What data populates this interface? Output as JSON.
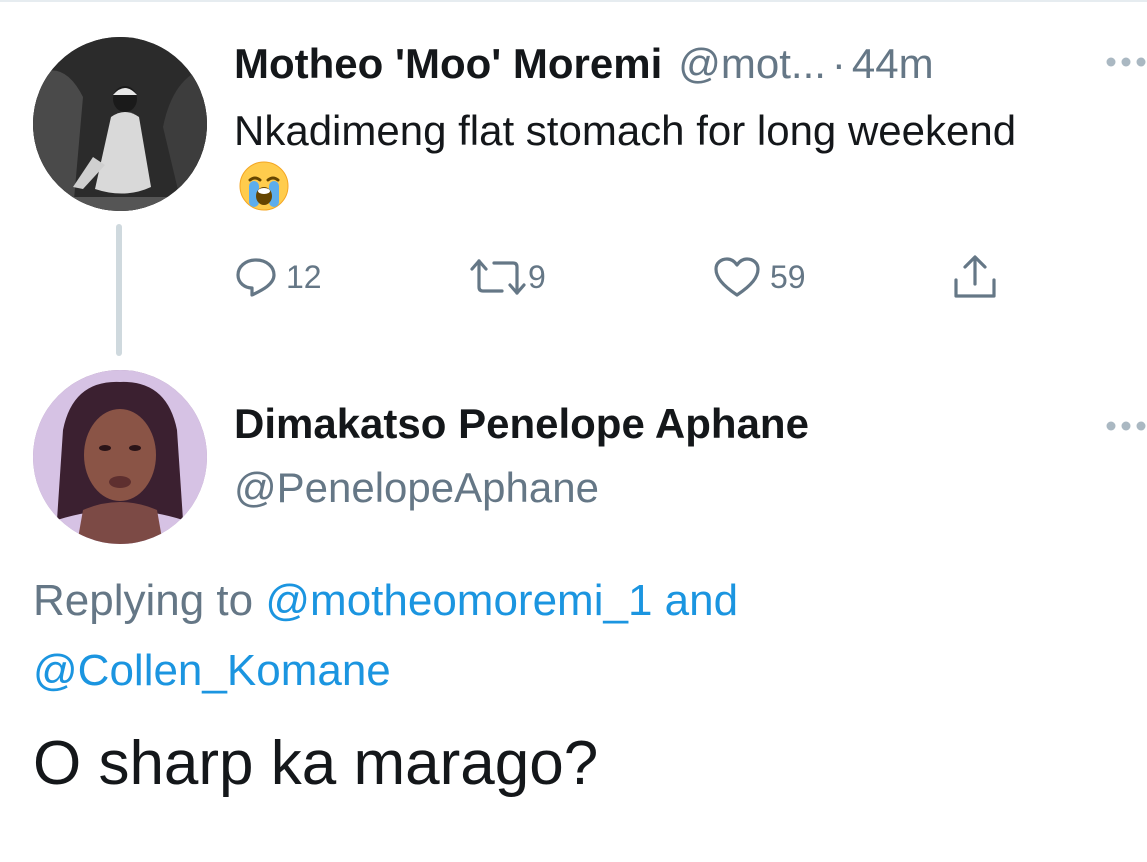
{
  "parent_tweet": {
    "display_name": "Motheo 'Moo' Moremi",
    "handle": "@mot...",
    "separator": "·",
    "timestamp": "44m",
    "text": "Nkadimeng flat stomach for long weekend",
    "emoji": "loudly-crying-face",
    "actions": {
      "reply_count": "12",
      "retweet_count": "9",
      "like_count": "59",
      "reply_icon": "reply-icon",
      "retweet_icon": "retweet-icon",
      "like_icon": "heart-icon",
      "share_icon": "share-icon"
    }
  },
  "reply_tweet": {
    "display_name": "Dimakatso Penelope Aphane",
    "handle": "@PenelopeAphane",
    "replying_prefix": "Replying to",
    "mention_1": "@motheomoremi_1",
    "mention_joiner": "and",
    "mention_2": "@Collen_Komane",
    "text": "O sharp ka marago?"
  },
  "colors": {
    "text": "#14171a",
    "secondary": "#657786",
    "link": "#1b95e0",
    "thread_line": "#cfd9de"
  }
}
